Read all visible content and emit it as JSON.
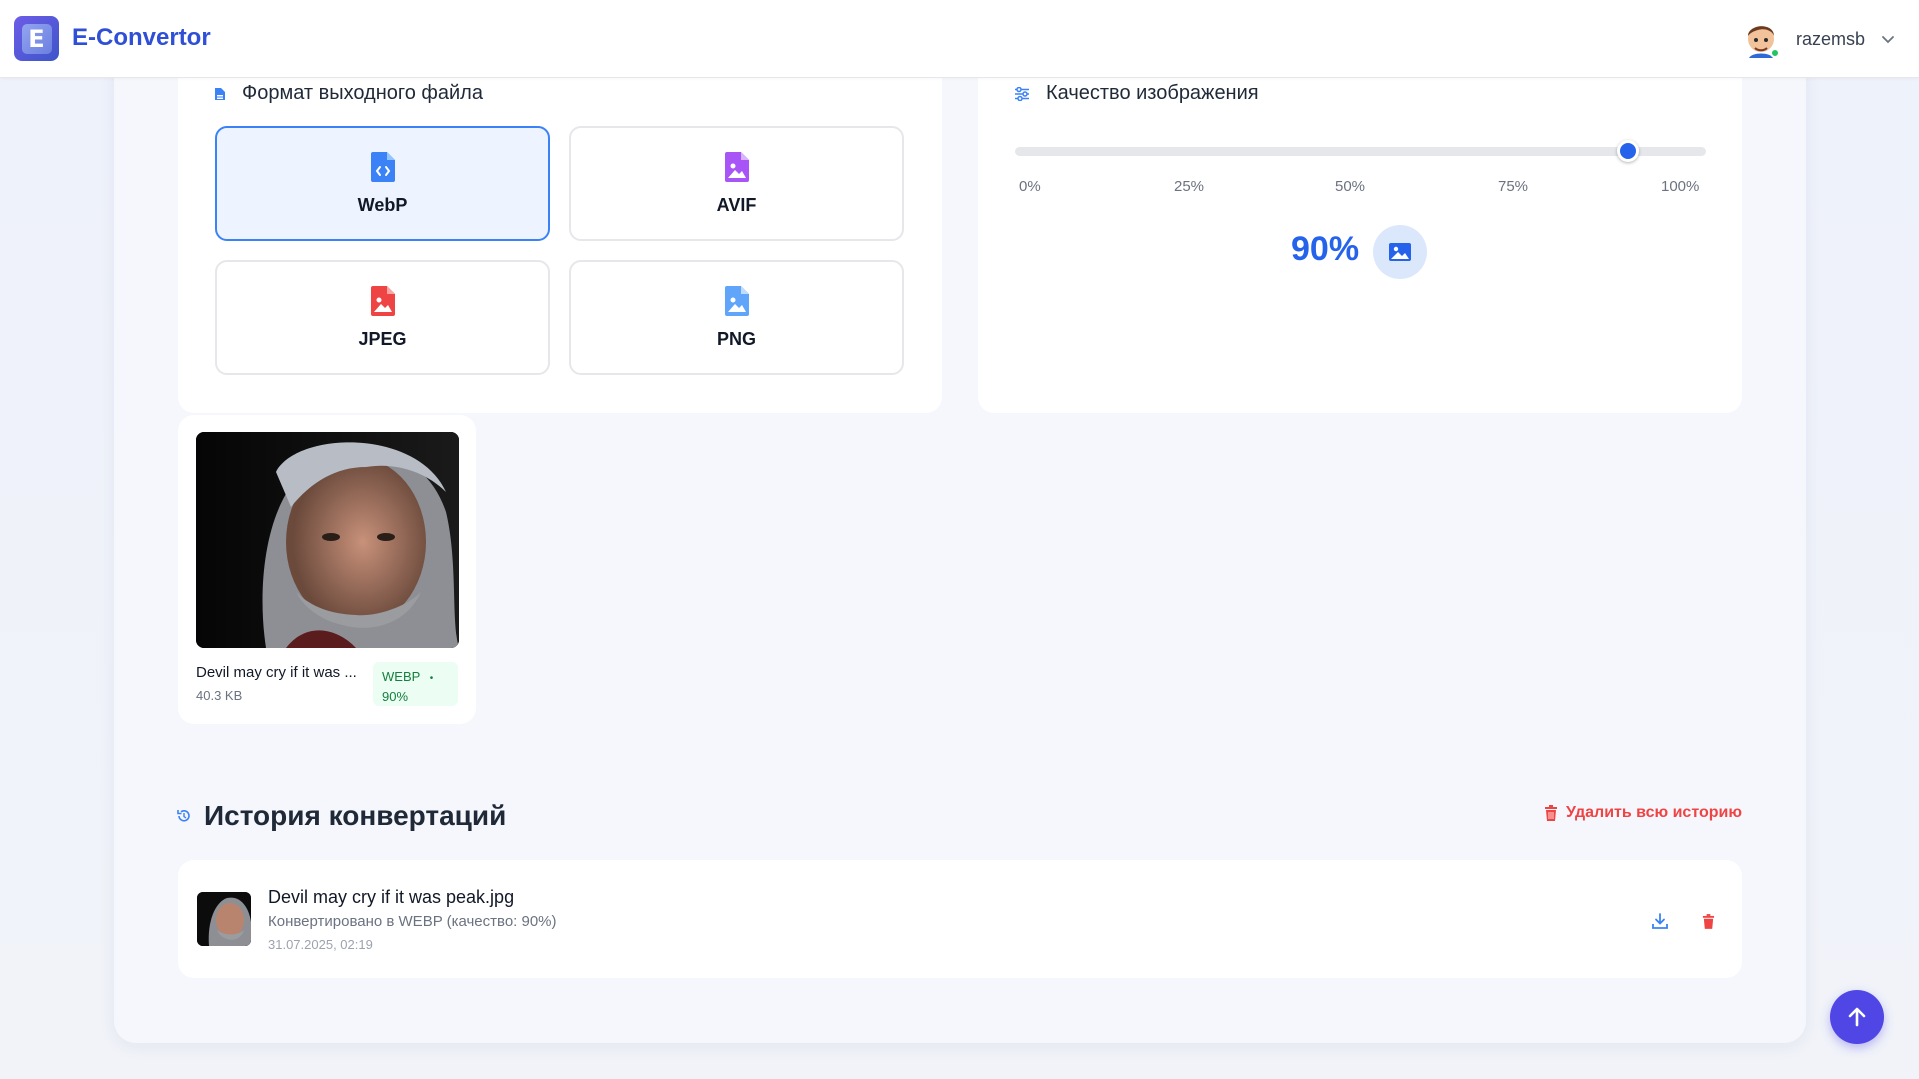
{
  "app": {
    "name": "E-Convertor",
    "logo_letter": "E"
  },
  "user": {
    "name": "razemsb",
    "status_color": "#22c55e"
  },
  "format_card": {
    "title": "Формат выходного файла",
    "options": [
      {
        "label": "WebP",
        "icon": "file-code-icon",
        "color": "#3b82f6",
        "selected": true
      },
      {
        "label": "AVIF",
        "icon": "file-image-icon",
        "color": "#a855f7",
        "selected": false
      },
      {
        "label": "JPEG",
        "icon": "file-image-icon",
        "color": "#ef4444",
        "selected": false
      },
      {
        "label": "PNG",
        "icon": "file-image-icon",
        "color": "#60a5fa",
        "selected": false
      }
    ]
  },
  "quality_card": {
    "title": "Качество изображения",
    "ticks": [
      "0%",
      "25%",
      "50%",
      "75%",
      "100%"
    ],
    "value": 90,
    "value_label": "90%"
  },
  "preview": {
    "file_name": "Devil may cry if it was ...",
    "file_size": "40.3 KB",
    "badge_format": "WEBP",
    "badge_dot": "•",
    "badge_quality": "90%"
  },
  "history": {
    "title": "История конвертаций",
    "clear_label": "Удалить всю историю",
    "items": [
      {
        "name": "Devil may cry if it was peak.jpg",
        "description": "Конвертировано в WEBP (качество: 90%)",
        "date": "31.07.2025, 02:19"
      }
    ]
  },
  "colors": {
    "accent": "#2563eb",
    "brand": "#2f4fd6",
    "danger": "#ef4444",
    "fab": "#4f46e5"
  }
}
